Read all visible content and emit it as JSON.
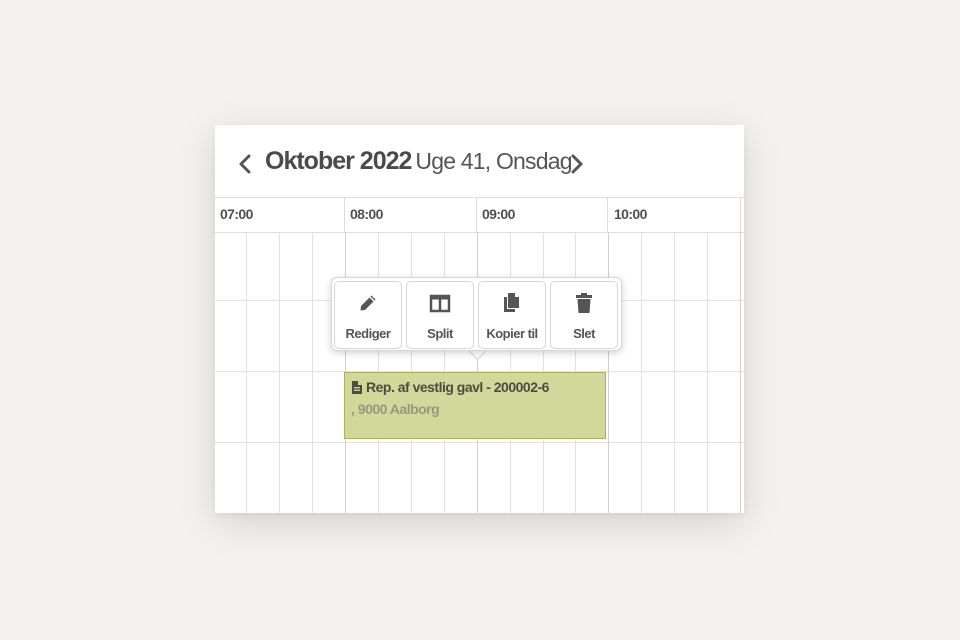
{
  "header": {
    "month_year": "Oktober 2022",
    "week_day": "Uge 41, Onsdag",
    "prev_icon": "chevron-left-icon",
    "next_icon": "chevron-right-icon"
  },
  "timeline": {
    "hours": [
      "07:00",
      "08:00",
      "09:00",
      "10:00"
    ]
  },
  "event": {
    "icon": "document-icon",
    "title": "Rep. af vestlig gavl - 200002-6",
    "subtitle": ", 9000 Aalborg",
    "color": "#d1d89a"
  },
  "actions": [
    {
      "label": "Rediger",
      "icon": "pencil-icon"
    },
    {
      "label": "Split",
      "icon": "split-columns-icon"
    },
    {
      "label": "Kopier til",
      "icon": "copy-icon"
    },
    {
      "label": "Slet",
      "icon": "trash-icon"
    }
  ]
}
